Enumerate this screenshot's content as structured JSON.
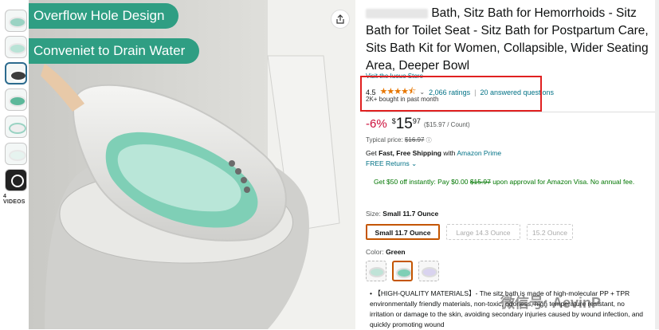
{
  "banners": [
    "Overflow Hole Design",
    "Conveniet to Drain Water"
  ],
  "video_label": "4 VIDEOS",
  "title": "Bath, Sitz Bath for Hemorrhoids - Sitz Bath for Toilet Seat - Sitz Bath for Postpartum Care, Sits Bath Kit for Women, Collapsible, Wider Seating Area, Deeper Bowl",
  "store_link": "Visit the Iuouo Store",
  "rating": {
    "value": "4.5",
    "stars": "★★★★⯪",
    "count": "2,066 ratings",
    "separator": "|",
    "questions": "20 answered questions",
    "bought": "2K+ bought in past month"
  },
  "price": {
    "discount": "-6%",
    "currency": "$",
    "whole": "15",
    "fraction": "97",
    "per_unit": "($15.97 / Count)",
    "typical_label": "Typical price:",
    "typical_value": "$16.97"
  },
  "shipping": {
    "prefix": "Get",
    "bold": "Fast, Free Shipping",
    "with": "with",
    "prime": "Amazon Prime",
    "returns": "FREE Returns ⌄"
  },
  "offer": {
    "text1": "Get $50 off instantly: Pay $0.00",
    "strike": "$15.97",
    "text2": "upon approval for Amazon Visa. No annual fee."
  },
  "size": {
    "label": "Size:",
    "selected": "Small 11.7 Ounce",
    "options": [
      "Small 11.7 Ounce",
      "Large 14.3 Ounce",
      "15.2 Ounce"
    ]
  },
  "color": {
    "label": "Color:",
    "selected": "Green"
  },
  "feature": {
    "text": "【HIGH-QUALITY MATERIALS】- The sitz bath is made of high-molecular PP + TPR environmentally friendly materials, non-toxic, odorless, high temperature resistant, no irritation or damage to the skin, avoiding secondary injuries caused by wound infection, and quickly promoting wound"
  },
  "watermark": "微信号: AevinP",
  "colors": {
    "accent": "#2f9e83",
    "link": "#007185",
    "deal": "#cc0c39",
    "highlight": "#e02020"
  }
}
